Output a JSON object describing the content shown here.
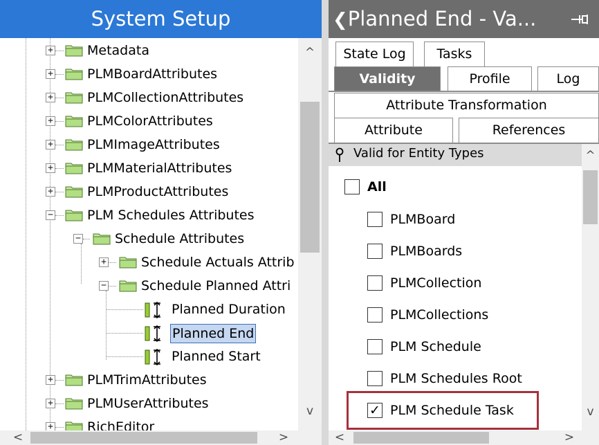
{
  "left_panel": {
    "title": "System Setup",
    "tree": [
      {
        "label": "Metadata",
        "expander": "+",
        "icon": "folder-icon"
      },
      {
        "label": "PLMBoardAttributes",
        "expander": "+",
        "icon": "folder-icon"
      },
      {
        "label": "PLMCollectionAttributes",
        "expander": "+",
        "icon": "folder-icon"
      },
      {
        "label": "PLMColorAttributes",
        "expander": "+",
        "icon": "folder-icon"
      },
      {
        "label": "PLMImageAttributes",
        "expander": "+",
        "icon": "folder-icon"
      },
      {
        "label": "PLMMaterialAttributes",
        "expander": "+",
        "icon": "folder-icon"
      },
      {
        "label": "PLMProductAttributes",
        "expander": "+",
        "icon": "folder-icon"
      },
      {
        "label": "PLM Schedules Attributes",
        "expander": "−",
        "icon": "folder-icon"
      },
      {
        "label": "Schedule Attributes",
        "expander": "−",
        "icon": "folder-icon"
      },
      {
        "label": "Schedule Actuals Attrib",
        "expander": "+",
        "icon": "folder-icon"
      },
      {
        "label": "Schedule Planned Attri",
        "expander": "−",
        "icon": "folder-icon"
      },
      {
        "label": "Planned Duration",
        "expander": "",
        "icon": "attribute-icon"
      },
      {
        "label": "Planned End",
        "expander": "",
        "icon": "attribute-icon",
        "selected": true
      },
      {
        "label": "Planned Start",
        "expander": "",
        "icon": "attribute-icon"
      },
      {
        "label": "PLMTrimAttributes",
        "expander": "+",
        "icon": "folder-icon"
      },
      {
        "label": "PLMUserAttributes",
        "expander": "+",
        "icon": "folder-icon"
      },
      {
        "label": "RichEditor",
        "expander": "+",
        "icon": "folder-icon"
      }
    ],
    "scroll_up": "^",
    "scroll_down": "v",
    "scroll_left": "<",
    "scroll_right": ">"
  },
  "right_panel": {
    "back_glyph": "❮",
    "title": "Planned End - Va...",
    "pin_icon": "pin-icon",
    "tabs_row1": [
      "State Log",
      "Tasks"
    ],
    "tabs_row2": [
      "Validity",
      "Profile",
      "Log"
    ],
    "tabs_row3": [
      "Attribute Transformation"
    ],
    "tabs_row4": [
      "Attribute",
      "References"
    ],
    "active_tab": "Validity",
    "section": {
      "icon": "pin-marker-icon",
      "title": "Valid for Entity Types"
    },
    "all_label": "All",
    "all_checked": false,
    "entity_types": [
      {
        "label": "PLMBoard",
        "checked": false
      },
      {
        "label": "PLMBoards",
        "checked": false
      },
      {
        "label": "PLMCollection",
        "checked": false
      },
      {
        "label": "PLMCollections",
        "checked": false
      },
      {
        "label": "PLM Schedule",
        "checked": false
      },
      {
        "label": "PLM Schedules Root",
        "checked": false
      },
      {
        "label": "PLM Schedule Task",
        "checked": true,
        "highlighted": true
      }
    ],
    "check_glyph": "✓",
    "scroll_up": "^",
    "scroll_down": "v",
    "scroll_left": "<",
    "scroll_right": ">"
  },
  "colors": {
    "left_header": "#2b78d6",
    "right_header": "#6d6d6d",
    "active_tab": "#707070",
    "highlight": "#a6313c",
    "selection": "#c5d7f1",
    "folder": "#c6e8a0"
  }
}
